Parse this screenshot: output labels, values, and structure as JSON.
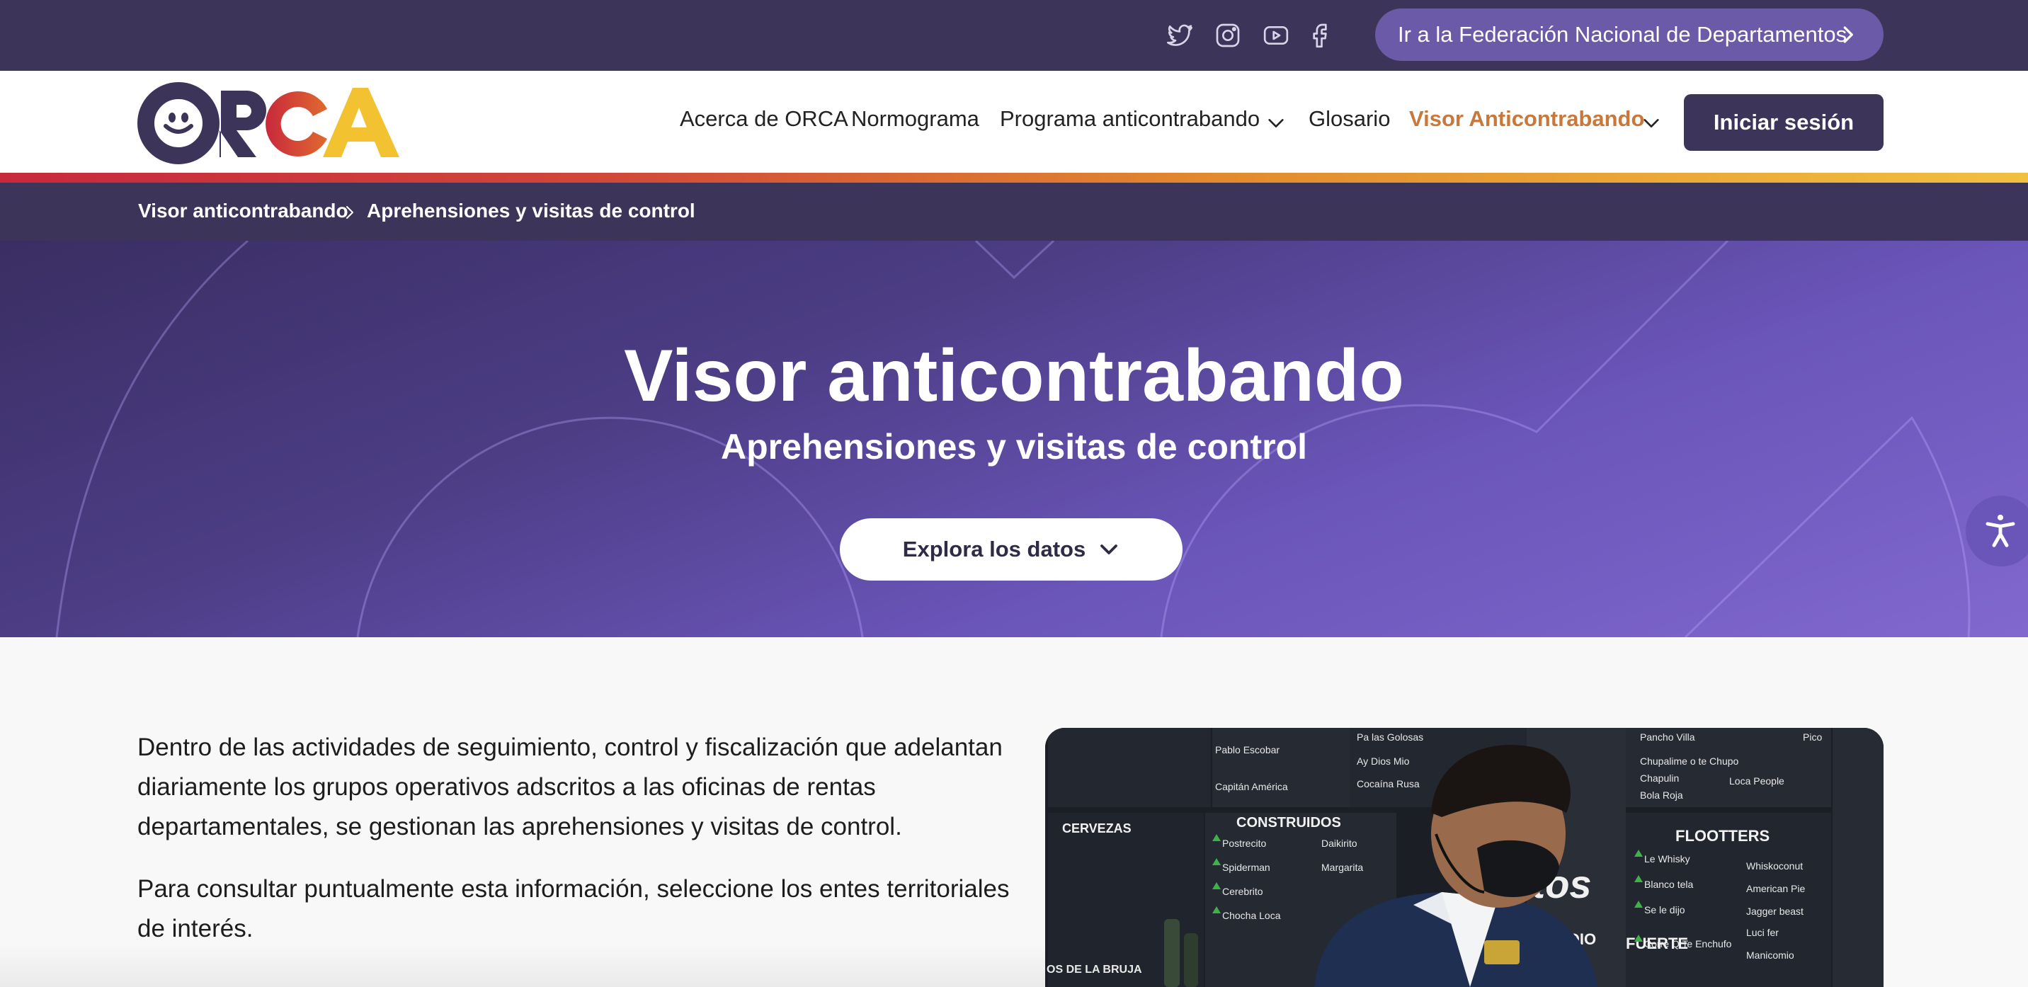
{
  "topbar": {
    "social_icons": [
      "twitter-icon",
      "instagram-icon",
      "youtube-icon",
      "facebook-icon"
    ],
    "federation_link": "Ir a la Federación Nacional de Departamentos"
  },
  "header": {
    "logo_text": "ORCA",
    "nav": {
      "about": "Acerca de ORCA",
      "normogram": "Normograma",
      "program": "Programa anticontrabando",
      "glossary": "Glosario",
      "viewer": "Visor Anticontrabando"
    },
    "login": "Iniciar sesión"
  },
  "breadcrumb": {
    "parent": "Visor anticontrabando",
    "current": "Aprehensiones y visitas de control"
  },
  "hero": {
    "title": "Visor anticontrabando",
    "subtitle": "Aprehensiones y visitas de control",
    "cta": "Explora los datos"
  },
  "content": {
    "paragraph_1": "Dentro de las actividades de seguimiento, control y fiscalización que adelantan diariamente los grupos operativos adscritos a las oficinas de rentas departamentales, se gestionan las aprehensiones y visitas de control.",
    "paragraph_2": "Para consultar puntualmente esta información, seleccione los entes territoriales de interés."
  },
  "photo_signs": {
    "cervezas": "CERVEZAS",
    "construidos": "CONSTRUIDOS",
    "flootters": "FLOOTTERS",
    "medio": "MEDIO",
    "fuerte": "FUERTE",
    "bruja": "OS DE LA BRUJA",
    "items": [
      "Postrecito",
      "Daikirito",
      "Spiderman",
      "Margarita",
      "Cerebrito",
      "Chocha Loca",
      "Le Whisky",
      "Whiskoconut",
      "Blanco tela",
      "American Pie",
      "Se le dijo",
      "Jagger beast",
      "Luci fer",
      "Corre Q Te Enchufo",
      "Manicomio",
      "Pancho Villa",
      "Chupalime o te Chupo",
      "Chapulin",
      "Bola Roja",
      "Loca People",
      "Pa las Golosas",
      "Ay Dios Mio",
      "Cocaína Rusa",
      "Capitán América",
      "Pablo Escobar",
      "Pico"
    ]
  },
  "colors": {
    "dark_purple": "#3d3459",
    "hero_purple": "#6a55b8",
    "active_orange": "#c8783a"
  }
}
